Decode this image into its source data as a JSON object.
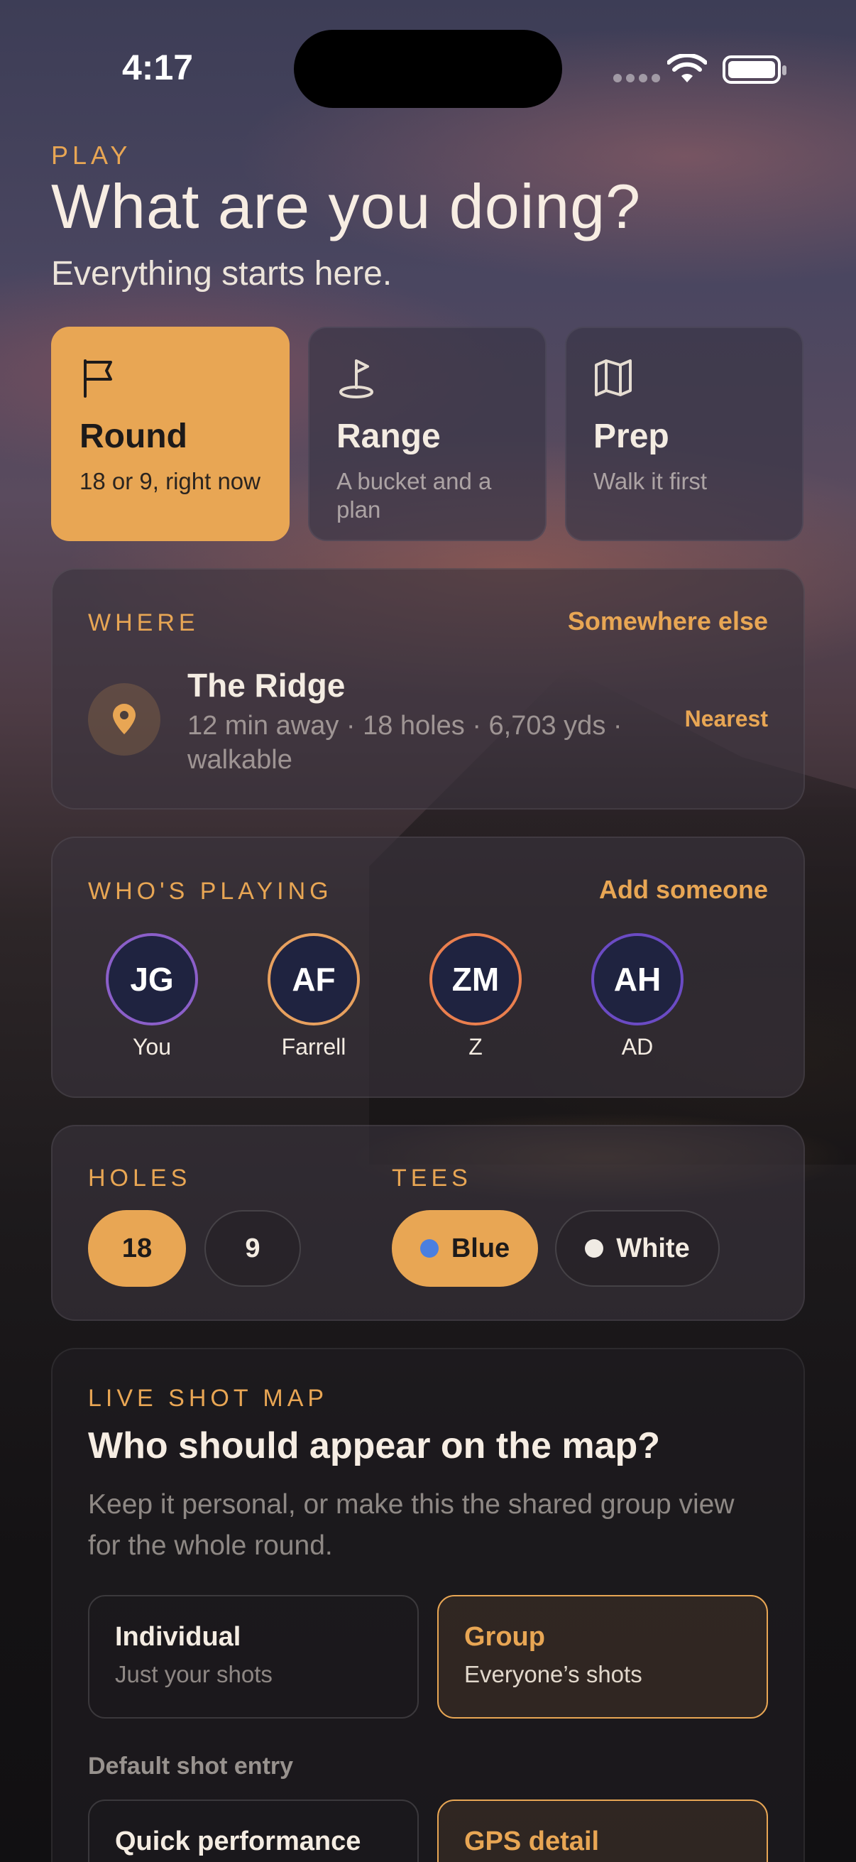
{
  "status": {
    "time": "4:17"
  },
  "header": {
    "eyebrow": "PLAY",
    "title": "What are you doing?",
    "subtitle": "Everything starts here."
  },
  "modes": [
    {
      "title": "Round",
      "subtitle": "18 or 9, right now",
      "icon": "flag-icon",
      "active": true
    },
    {
      "title": "Range",
      "subtitle": "A bucket and a plan",
      "icon": "pin-flag-icon",
      "active": false
    },
    {
      "title": "Prep",
      "subtitle": "Walk it first",
      "icon": "map-icon",
      "active": false
    }
  ],
  "where": {
    "label": "WHERE",
    "change_link": "Somewhere else",
    "course_name": "The Ridge",
    "course_meta": "12 min away · 18 holes · 6,703 yds · walkable",
    "badge": "Nearest"
  },
  "players": {
    "label": "WHO'S PLAYING",
    "add_link": "Add someone",
    "list": [
      {
        "initials": "JG",
        "name": "You"
      },
      {
        "initials": "AF",
        "name": "Farrell"
      },
      {
        "initials": "ZM",
        "name": "Z"
      },
      {
        "initials": "AH",
        "name": "AD"
      }
    ]
  },
  "holes": {
    "label": "HOLES",
    "options": [
      "18",
      "9"
    ],
    "selected": "18"
  },
  "tees": {
    "label": "TEES",
    "options": [
      {
        "name": "Blue",
        "color": "#4a7fe0"
      },
      {
        "name": "White",
        "color": "#f0ebe4"
      }
    ],
    "selected": "Blue"
  },
  "shotmap": {
    "label": "LIVE SHOT MAP",
    "title": "Who should appear on the map?",
    "description": "Keep it personal, or make this the shared group view for the whole round.",
    "options": [
      {
        "title": "Individual",
        "subtitle": "Just your shots"
      },
      {
        "title": "Group",
        "subtitle": "Everyone’s shots"
      }
    ],
    "selected": "Group",
    "default_entry_label": "Default shot entry",
    "entry_options": [
      "Quick performance",
      "GPS detail"
    ],
    "entry_selected": "GPS detail"
  },
  "colors": {
    "accent": "#e8a654",
    "card": "#3a3646"
  }
}
